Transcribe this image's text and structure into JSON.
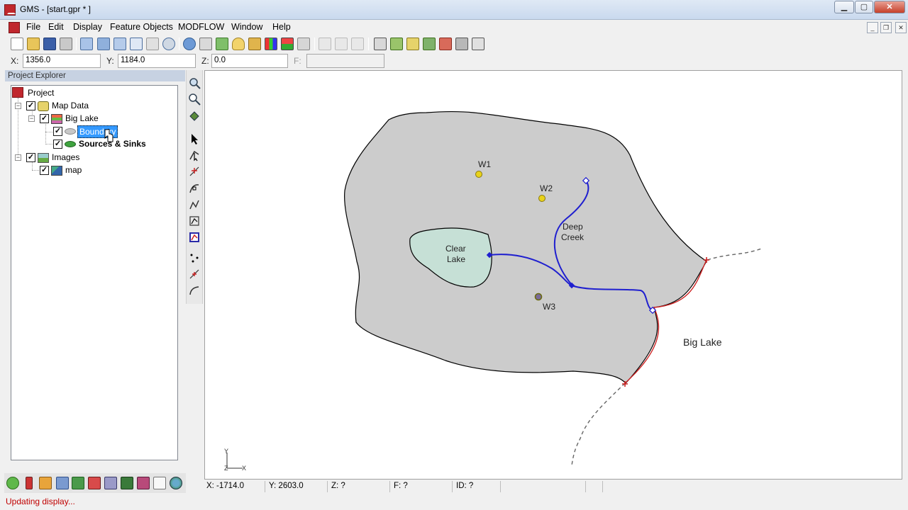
{
  "window": {
    "title": "GMS - [start.gpr * ]"
  },
  "window_controls": {
    "minimize": "▁",
    "maximize": "▢",
    "close": "✕"
  },
  "mdi_controls": {
    "minimize": "_",
    "restore": "❐",
    "close": "✕"
  },
  "menu": [
    "File",
    "Edit",
    "Display",
    "Feature Objects",
    "MODFLOW",
    "Window",
    "Help"
  ],
  "coords": {
    "x_label": "X:",
    "x_value": "1356.0",
    "y_label": "Y:",
    "y_value": "1184.0",
    "z_label": "Z:",
    "z_value": "0.0",
    "f_label": "F:",
    "f_value": ""
  },
  "explorer": {
    "title": "Project Explorer",
    "project": "Project",
    "map_data": "Map Data",
    "big_lake": "Big Lake",
    "boundary": "Boundary",
    "sources_sinks": "Sources & Sinks",
    "images": "Images",
    "map": "map"
  },
  "map": {
    "labels": {
      "w1": "W1",
      "w2": "W2",
      "w3": "W3",
      "deep": "Deep",
      "creek": "Creek",
      "clear": "Clear",
      "lake": "Lake",
      "big_lake": "Big Lake"
    },
    "triad_y": "Y",
    "triad_z": "Z",
    "triad_x": "X",
    "colors": {
      "boundary_fill": "#cccccc",
      "lake_fill": "#c6e0d6",
      "stream": "#1f1fcf",
      "specified_head": "#cc2222",
      "well": "#e8d21a"
    }
  },
  "status": {
    "x": "X: -1714.0",
    "y": "Y: 2603.0",
    "z": "Z: ?",
    "f": "F: ?",
    "id": "ID: ?",
    "message": "Updating display..."
  }
}
